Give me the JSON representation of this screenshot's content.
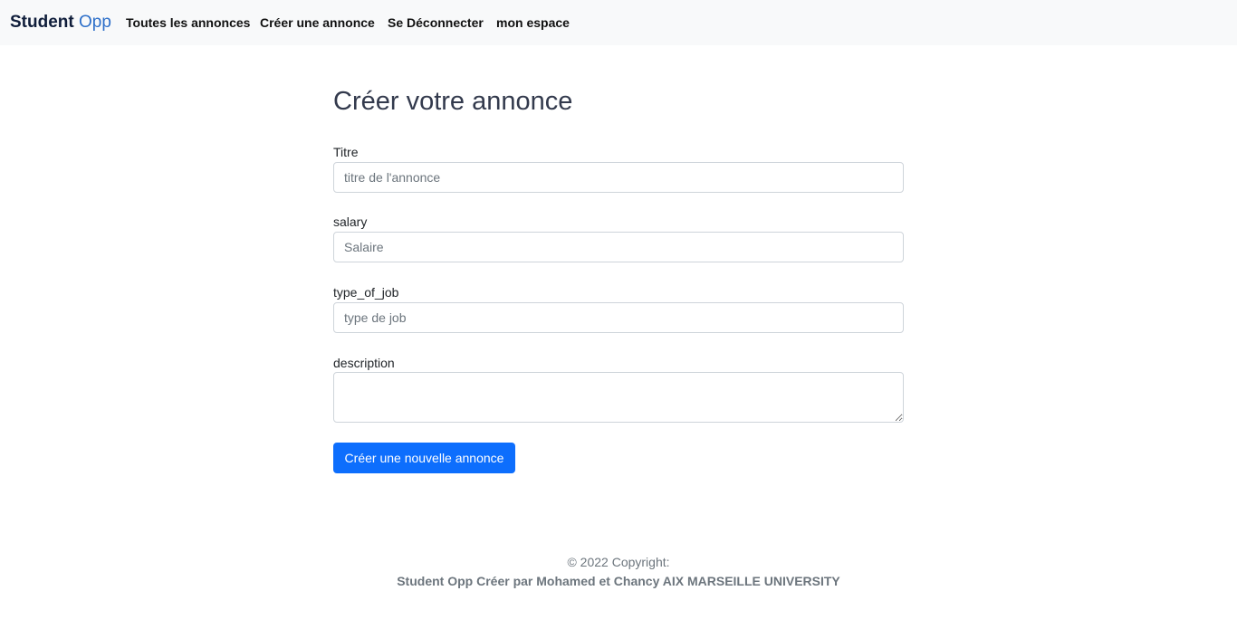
{
  "navbar": {
    "brand_bold": "Student",
    "brand_light": "Opp",
    "links": [
      "Toutes les annonces",
      "Créer une annonce",
      "Se Déconnecter",
      "mon espace"
    ]
  },
  "form": {
    "title": "Créer votre annonce",
    "fields": [
      {
        "label": "Titre",
        "placeholder": "titre de l'annonce"
      },
      {
        "label": "salary",
        "placeholder": "Salaire"
      },
      {
        "label": "type_of_job",
        "placeholder": "type de job"
      },
      {
        "label": "description",
        "placeholder": ""
      }
    ],
    "submit_label": "Créer une nouvelle annonce"
  },
  "footer": {
    "copyright": "© 2022 Copyright:",
    "credits": "Student Opp Créer par Mohamed et Chancy AIX MARSEILLE UNIVERSITY"
  },
  "colors": {
    "primary": "#0d6efd",
    "navbar_bg": "#f8f9fa",
    "brand_accent": "#2d6fc9"
  }
}
